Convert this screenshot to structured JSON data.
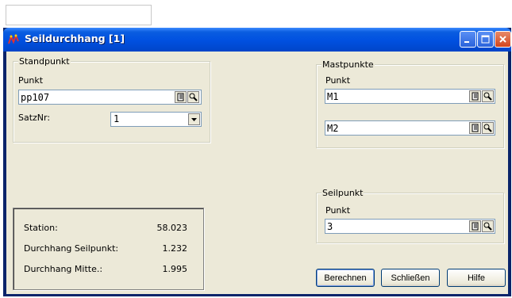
{
  "window": {
    "title": "Seildurchhang [1]"
  },
  "standpunkt": {
    "legend": "Standpunkt",
    "punkt_label": "Punkt",
    "punkt_value": "pp107",
    "satznr_label": "SatzNr:",
    "satznr_value": "1"
  },
  "mastpunkte": {
    "legend": "Mastpunkte",
    "punkt_label": "Punkt",
    "m1_value": "M1",
    "m2_value": "M2"
  },
  "seilpunkt": {
    "legend": "Seilpunkt",
    "punkt_label": "Punkt",
    "punkt_value": "3"
  },
  "results": [
    {
      "name": "Station:",
      "value": "58.023"
    },
    {
      "name": "Durchhang Seilpunkt:",
      "value": "1.232"
    },
    {
      "name": "Durchhang Mitte.:",
      "value": "1.995"
    }
  ],
  "buttons": {
    "berechnen": "Berechnen",
    "schliessen": "Schließen",
    "hilfe": "Hilfe"
  },
  "icons": {
    "title": "app-icon",
    "field_pick": "notebook-icon",
    "field_search": "search-icon"
  }
}
